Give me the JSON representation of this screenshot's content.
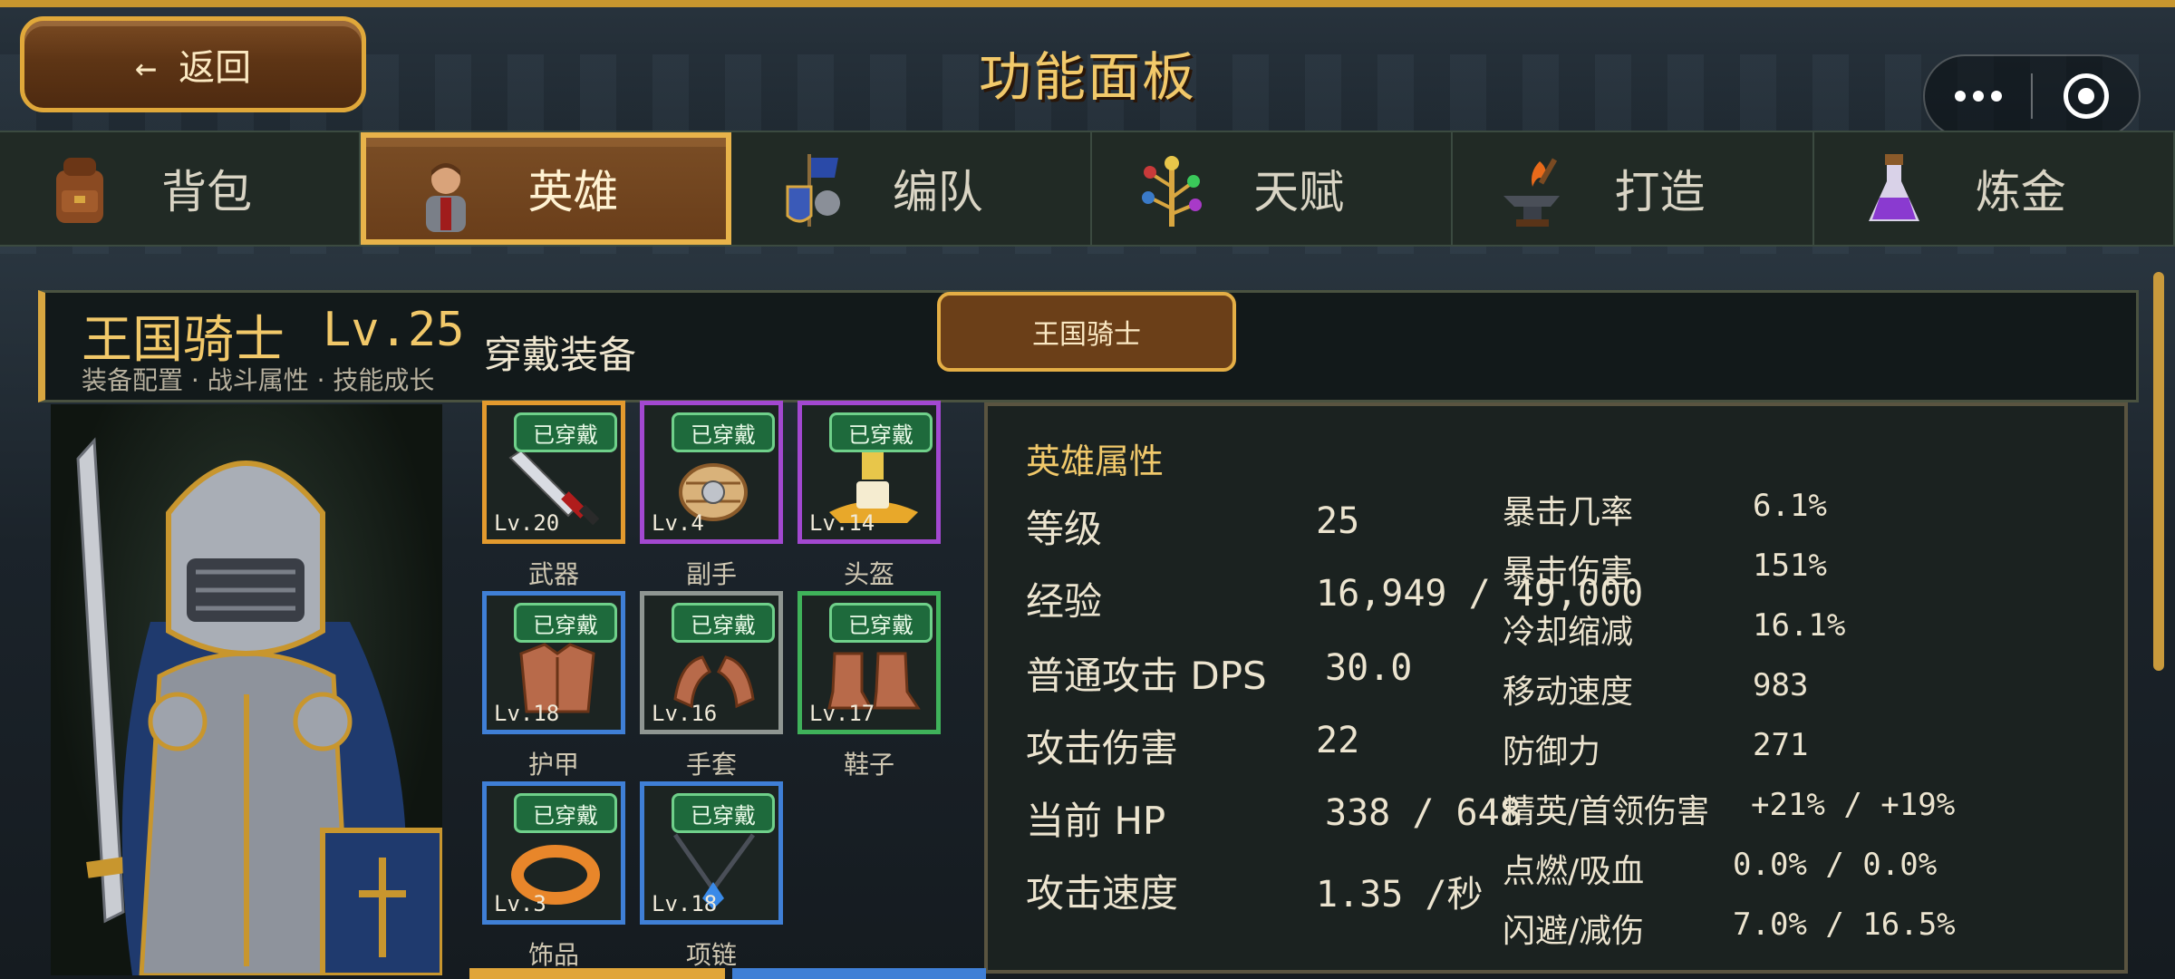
{
  "header": {
    "back_label": "← 返回",
    "title": "功能面板"
  },
  "tabs": [
    {
      "label": "背包",
      "icon": "backpack-icon"
    },
    {
      "label": "英雄",
      "icon": "hero-icon",
      "active": true
    },
    {
      "label": "编队",
      "icon": "formation-icon"
    },
    {
      "label": "天赋",
      "icon": "talent-tree-icon"
    },
    {
      "label": "打造",
      "icon": "anvil-icon"
    },
    {
      "label": "炼金",
      "icon": "potion-icon"
    }
  ],
  "hero": {
    "name": "王国骑士",
    "level": "Lv.25",
    "subtitle": "装备配置 · 战斗属性 · 技能成长",
    "section_title": "穿戴装备",
    "class_button": "王国骑士"
  },
  "equipment": [
    {
      "label": "武器",
      "level": "Lv.20",
      "status": "已穿戴",
      "rarity": "orange",
      "icon": "sword-icon"
    },
    {
      "label": "副手",
      "level": "Lv.4",
      "status": "已穿戴",
      "rarity": "purple",
      "icon": "shield-icon"
    },
    {
      "label": "头盔",
      "level": "Lv.14",
      "status": "已穿戴",
      "rarity": "purple",
      "icon": "helmet-icon"
    },
    {
      "label": "护甲",
      "level": "Lv.18",
      "status": "已穿戴",
      "rarity": "blue",
      "icon": "armor-icon"
    },
    {
      "label": "手套",
      "level": "Lv.16",
      "status": "已穿戴",
      "rarity": "gray",
      "icon": "gloves-icon"
    },
    {
      "label": "鞋子",
      "level": "Lv.17",
      "status": "已穿戴",
      "rarity": "green",
      "icon": "boots-icon"
    },
    {
      "label": "饰品",
      "level": "Lv.3",
      "status": "已穿戴",
      "rarity": "blue",
      "icon": "ring-icon"
    },
    {
      "label": "项链",
      "level": "Lv.18",
      "status": "已穿戴",
      "rarity": "blue",
      "icon": "necklace-icon"
    }
  ],
  "stats": {
    "title": "英雄属性",
    "left": [
      {
        "label": "等级",
        "value": "25"
      },
      {
        "label": "经验",
        "value": "16,949 / 49,000"
      },
      {
        "label": "普通攻击 DPS",
        "value": "30.0"
      },
      {
        "label": "攻击伤害",
        "value": "22"
      },
      {
        "label": "当前 HP",
        "value": "338 / 648"
      },
      {
        "label": "攻击速度",
        "value": "1.35 /秒"
      }
    ],
    "right": [
      {
        "label": "暴击几率",
        "value": "6.1%"
      },
      {
        "label": "暴击伤害",
        "value": "151%"
      },
      {
        "label": "冷却缩减",
        "value": "16.1%"
      },
      {
        "label": "移动速度",
        "value": "983"
      },
      {
        "label": "防御力",
        "value": "271"
      },
      {
        "label": "精英/首领伤害",
        "value": "+21% / +19%"
      },
      {
        "label": "点燃/吸血",
        "value": "0.0% / 0.0%"
      },
      {
        "label": "闪避/减伤",
        "value": "7.0% / 16.5%"
      }
    ]
  },
  "colors": {
    "accent": "#e8b34a",
    "title_gold": "#f2c96a",
    "worn_badge": "#1e6a3c"
  }
}
